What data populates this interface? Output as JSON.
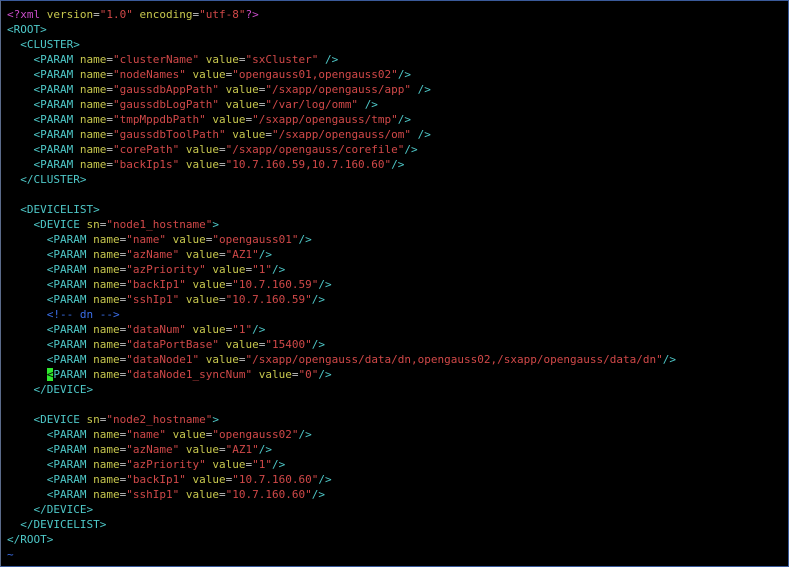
{
  "colors": {
    "background": "#000000",
    "tag": "#4ec8c8",
    "attribute_name": "#c8c84e",
    "attribute_value": "#d04848",
    "comment": "#3a6ee8",
    "declaration": "#c84cc8",
    "cursor": "#2ee82e"
  },
  "cursor": {
    "line": 24,
    "column": 3
  },
  "lines": [
    {
      "indent": "",
      "tokens": [
        [
          "decl",
          "<?"
        ],
        [
          "decl",
          "xml"
        ],
        [
          "plain",
          " "
        ],
        [
          "attr",
          "version"
        ],
        [
          "eq",
          "="
        ],
        [
          "str",
          "\"1.0\""
        ],
        [
          "plain",
          " "
        ],
        [
          "attr",
          "encoding"
        ],
        [
          "eq",
          "="
        ],
        [
          "str",
          "\"utf-8\""
        ],
        [
          "decl",
          "?>"
        ]
      ]
    },
    {
      "indent": "",
      "tokens": [
        [
          "tag",
          "<ROOT>"
        ]
      ]
    },
    {
      "indent": "  ",
      "tokens": [
        [
          "tag",
          "<CLUSTER>"
        ]
      ]
    },
    {
      "indent": "    ",
      "tokens": [
        [
          "tag",
          "<PARAM"
        ],
        [
          "plain",
          " "
        ],
        [
          "attr",
          "name"
        ],
        [
          "eq",
          "="
        ],
        [
          "str",
          "\"clusterName\""
        ],
        [
          "plain",
          " "
        ],
        [
          "attr",
          "value"
        ],
        [
          "eq",
          "="
        ],
        [
          "str",
          "\"sxCluster\""
        ],
        [
          "plain",
          " "
        ],
        [
          "tag",
          "/>"
        ]
      ]
    },
    {
      "indent": "    ",
      "tokens": [
        [
          "tag",
          "<PARAM"
        ],
        [
          "plain",
          " "
        ],
        [
          "attr",
          "name"
        ],
        [
          "eq",
          "="
        ],
        [
          "str",
          "\"nodeNames\""
        ],
        [
          "plain",
          " "
        ],
        [
          "attr",
          "value"
        ],
        [
          "eq",
          "="
        ],
        [
          "str",
          "\"opengauss01,opengauss02\""
        ],
        [
          "tag",
          "/>"
        ]
      ]
    },
    {
      "indent": "    ",
      "tokens": [
        [
          "tag",
          "<PARAM"
        ],
        [
          "plain",
          " "
        ],
        [
          "attr",
          "name"
        ],
        [
          "eq",
          "="
        ],
        [
          "str",
          "\"gaussdbAppPath\""
        ],
        [
          "plain",
          " "
        ],
        [
          "attr",
          "value"
        ],
        [
          "eq",
          "="
        ],
        [
          "str",
          "\"/sxapp/opengauss/app\""
        ],
        [
          "plain",
          " "
        ],
        [
          "tag",
          "/>"
        ]
      ]
    },
    {
      "indent": "    ",
      "tokens": [
        [
          "tag",
          "<PARAM"
        ],
        [
          "plain",
          " "
        ],
        [
          "attr",
          "name"
        ],
        [
          "eq",
          "="
        ],
        [
          "str",
          "\"gaussdbLogPath\""
        ],
        [
          "plain",
          " "
        ],
        [
          "attr",
          "value"
        ],
        [
          "eq",
          "="
        ],
        [
          "str",
          "\"/var/log/omm\""
        ],
        [
          "plain",
          " "
        ],
        [
          "tag",
          "/>"
        ]
      ]
    },
    {
      "indent": "    ",
      "tokens": [
        [
          "tag",
          "<PARAM"
        ],
        [
          "plain",
          " "
        ],
        [
          "attr",
          "name"
        ],
        [
          "eq",
          "="
        ],
        [
          "str",
          "\"tmpMppdbPath\""
        ],
        [
          "plain",
          " "
        ],
        [
          "attr",
          "value"
        ],
        [
          "eq",
          "="
        ],
        [
          "str",
          "\"/sxapp/opengauss/tmp\""
        ],
        [
          "tag",
          "/>"
        ]
      ]
    },
    {
      "indent": "    ",
      "tokens": [
        [
          "tag",
          "<PARAM"
        ],
        [
          "plain",
          " "
        ],
        [
          "attr",
          "name"
        ],
        [
          "eq",
          "="
        ],
        [
          "str",
          "\"gaussdbToolPath\""
        ],
        [
          "plain",
          " "
        ],
        [
          "attr",
          "value"
        ],
        [
          "eq",
          "="
        ],
        [
          "str",
          "\"/sxapp/opengauss/om\""
        ],
        [
          "plain",
          " "
        ],
        [
          "tag",
          "/>"
        ]
      ]
    },
    {
      "indent": "    ",
      "tokens": [
        [
          "tag",
          "<PARAM"
        ],
        [
          "plain",
          " "
        ],
        [
          "attr",
          "name"
        ],
        [
          "eq",
          "="
        ],
        [
          "str",
          "\"corePath\""
        ],
        [
          "plain",
          " "
        ],
        [
          "attr",
          "value"
        ],
        [
          "eq",
          "="
        ],
        [
          "str",
          "\"/sxapp/opengauss/corefile\""
        ],
        [
          "tag",
          "/>"
        ]
      ]
    },
    {
      "indent": "    ",
      "tokens": [
        [
          "tag",
          "<PARAM"
        ],
        [
          "plain",
          " "
        ],
        [
          "attr",
          "name"
        ],
        [
          "eq",
          "="
        ],
        [
          "str",
          "\"backIp1s\""
        ],
        [
          "plain",
          " "
        ],
        [
          "attr",
          "value"
        ],
        [
          "eq",
          "="
        ],
        [
          "str",
          "\"10.7.160.59,10.7.160.60\""
        ],
        [
          "tag",
          "/>"
        ]
      ]
    },
    {
      "indent": "  ",
      "tokens": [
        [
          "tag",
          "</CLUSTER>"
        ]
      ]
    },
    {
      "indent": "",
      "tokens": []
    },
    {
      "indent": "  ",
      "tokens": [
        [
          "tag",
          "<DEVICELIST>"
        ]
      ]
    },
    {
      "indent": "    ",
      "tokens": [
        [
          "tag",
          "<DEVICE"
        ],
        [
          "plain",
          " "
        ],
        [
          "attr",
          "sn"
        ],
        [
          "eq",
          "="
        ],
        [
          "str",
          "\"node1_hostname\""
        ],
        [
          "tag",
          ">"
        ]
      ]
    },
    {
      "indent": "      ",
      "tokens": [
        [
          "tag",
          "<PARAM"
        ],
        [
          "plain",
          " "
        ],
        [
          "attr",
          "name"
        ],
        [
          "eq",
          "="
        ],
        [
          "str",
          "\"name\""
        ],
        [
          "plain",
          " "
        ],
        [
          "attr",
          "value"
        ],
        [
          "eq",
          "="
        ],
        [
          "str",
          "\"opengauss01\""
        ],
        [
          "tag",
          "/>"
        ]
      ]
    },
    {
      "indent": "      ",
      "tokens": [
        [
          "tag",
          "<PARAM"
        ],
        [
          "plain",
          " "
        ],
        [
          "attr",
          "name"
        ],
        [
          "eq",
          "="
        ],
        [
          "str",
          "\"azName\""
        ],
        [
          "plain",
          " "
        ],
        [
          "attr",
          "value"
        ],
        [
          "eq",
          "="
        ],
        [
          "str",
          "\"AZ1\""
        ],
        [
          "tag",
          "/>"
        ]
      ]
    },
    {
      "indent": "      ",
      "tokens": [
        [
          "tag",
          "<PARAM"
        ],
        [
          "plain",
          " "
        ],
        [
          "attr",
          "name"
        ],
        [
          "eq",
          "="
        ],
        [
          "str",
          "\"azPriority\""
        ],
        [
          "plain",
          " "
        ],
        [
          "attr",
          "value"
        ],
        [
          "eq",
          "="
        ],
        [
          "str",
          "\"1\""
        ],
        [
          "tag",
          "/>"
        ]
      ]
    },
    {
      "indent": "      ",
      "tokens": [
        [
          "tag",
          "<PARAM"
        ],
        [
          "plain",
          " "
        ],
        [
          "attr",
          "name"
        ],
        [
          "eq",
          "="
        ],
        [
          "str",
          "\"backIp1\""
        ],
        [
          "plain",
          " "
        ],
        [
          "attr",
          "value"
        ],
        [
          "eq",
          "="
        ],
        [
          "str",
          "\"10.7.160.59\""
        ],
        [
          "tag",
          "/>"
        ]
      ]
    },
    {
      "indent": "      ",
      "tokens": [
        [
          "tag",
          "<PARAM"
        ],
        [
          "plain",
          " "
        ],
        [
          "attr",
          "name"
        ],
        [
          "eq",
          "="
        ],
        [
          "str",
          "\"sshIp1\""
        ],
        [
          "plain",
          " "
        ],
        [
          "attr",
          "value"
        ],
        [
          "eq",
          "="
        ],
        [
          "str",
          "\"10.7.160.59\""
        ],
        [
          "tag",
          "/>"
        ]
      ]
    },
    {
      "indent": "      ",
      "tokens": [
        [
          "comment",
          "<!-- dn -->"
        ]
      ]
    },
    {
      "indent": "      ",
      "tokens": [
        [
          "tag",
          "<PARAM"
        ],
        [
          "plain",
          " "
        ],
        [
          "attr",
          "name"
        ],
        [
          "eq",
          "="
        ],
        [
          "str",
          "\"dataNum\""
        ],
        [
          "plain",
          " "
        ],
        [
          "attr",
          "value"
        ],
        [
          "eq",
          "="
        ],
        [
          "str",
          "\"1\""
        ],
        [
          "tag",
          "/>"
        ]
      ]
    },
    {
      "indent": "      ",
      "tokens": [
        [
          "tag",
          "<PARAM"
        ],
        [
          "plain",
          " "
        ],
        [
          "attr",
          "name"
        ],
        [
          "eq",
          "="
        ],
        [
          "str",
          "\"dataPortBase\""
        ],
        [
          "plain",
          " "
        ],
        [
          "attr",
          "value"
        ],
        [
          "eq",
          "="
        ],
        [
          "str",
          "\"15400\""
        ],
        [
          "tag",
          "/>"
        ]
      ]
    },
    {
      "indent": "      ",
      "tokens": [
        [
          "tag",
          "<PARAM"
        ],
        [
          "plain",
          " "
        ],
        [
          "attr",
          "name"
        ],
        [
          "eq",
          "="
        ],
        [
          "str",
          "\"dataNode1\""
        ],
        [
          "plain",
          " "
        ],
        [
          "attr",
          "value"
        ],
        [
          "eq",
          "="
        ],
        [
          "str",
          "\"/sxapp/opengauss/data/dn,opengauss02,/sxapp/opengauss/data/dn\""
        ],
        [
          "tag",
          "/>"
        ]
      ]
    },
    {
      "indent": "      ",
      "tokens": [
        [
          "tag",
          "<PARAM"
        ],
        [
          "plain",
          " "
        ],
        [
          "attr",
          "name"
        ],
        [
          "eq",
          "="
        ],
        [
          "str",
          "\"dataNode1_syncNum\""
        ],
        [
          "plain",
          " "
        ],
        [
          "attr",
          "value"
        ],
        [
          "eq",
          "="
        ],
        [
          "str",
          "\"0\""
        ],
        [
          "tag",
          "/>"
        ]
      ]
    },
    {
      "indent": "    ",
      "tokens": [
        [
          "tag",
          "</DEVICE>"
        ]
      ]
    },
    {
      "indent": "",
      "tokens": []
    },
    {
      "indent": "    ",
      "tokens": [
        [
          "tag",
          "<DEVICE"
        ],
        [
          "plain",
          " "
        ],
        [
          "attr",
          "sn"
        ],
        [
          "eq",
          "="
        ],
        [
          "str",
          "\"node2_hostname\""
        ],
        [
          "tag",
          ">"
        ]
      ]
    },
    {
      "indent": "      ",
      "tokens": [
        [
          "tag",
          "<PARAM"
        ],
        [
          "plain",
          " "
        ],
        [
          "attr",
          "name"
        ],
        [
          "eq",
          "="
        ],
        [
          "str",
          "\"name\""
        ],
        [
          "plain",
          " "
        ],
        [
          "attr",
          "value"
        ],
        [
          "eq",
          "="
        ],
        [
          "str",
          "\"opengauss02\""
        ],
        [
          "tag",
          "/>"
        ]
      ]
    },
    {
      "indent": "      ",
      "tokens": [
        [
          "tag",
          "<PARAM"
        ],
        [
          "plain",
          " "
        ],
        [
          "attr",
          "name"
        ],
        [
          "eq",
          "="
        ],
        [
          "str",
          "\"azName\""
        ],
        [
          "plain",
          " "
        ],
        [
          "attr",
          "value"
        ],
        [
          "eq",
          "="
        ],
        [
          "str",
          "\"AZ1\""
        ],
        [
          "tag",
          "/>"
        ]
      ]
    },
    {
      "indent": "      ",
      "tokens": [
        [
          "tag",
          "<PARAM"
        ],
        [
          "plain",
          " "
        ],
        [
          "attr",
          "name"
        ],
        [
          "eq",
          "="
        ],
        [
          "str",
          "\"azPriority\""
        ],
        [
          "plain",
          " "
        ],
        [
          "attr",
          "value"
        ],
        [
          "eq",
          "="
        ],
        [
          "str",
          "\"1\""
        ],
        [
          "tag",
          "/>"
        ]
      ]
    },
    {
      "indent": "      ",
      "tokens": [
        [
          "tag",
          "<PARAM"
        ],
        [
          "plain",
          " "
        ],
        [
          "attr",
          "name"
        ],
        [
          "eq",
          "="
        ],
        [
          "str",
          "\"backIp1\""
        ],
        [
          "plain",
          " "
        ],
        [
          "attr",
          "value"
        ],
        [
          "eq",
          "="
        ],
        [
          "str",
          "\"10.7.160.60\""
        ],
        [
          "tag",
          "/>"
        ]
      ]
    },
    {
      "indent": "      ",
      "tokens": [
        [
          "tag",
          "<PARAM"
        ],
        [
          "plain",
          " "
        ],
        [
          "attr",
          "name"
        ],
        [
          "eq",
          "="
        ],
        [
          "str",
          "\"sshIp1\""
        ],
        [
          "plain",
          " "
        ],
        [
          "attr",
          "value"
        ],
        [
          "eq",
          "="
        ],
        [
          "str",
          "\"10.7.160.60\""
        ],
        [
          "tag",
          "/>"
        ]
      ]
    },
    {
      "indent": "    ",
      "tokens": [
        [
          "tag",
          "</DEVICE>"
        ]
      ]
    },
    {
      "indent": "  ",
      "tokens": [
        [
          "tag",
          "</DEVICELIST>"
        ]
      ]
    },
    {
      "indent": "",
      "tokens": [
        [
          "tag",
          "</ROOT>"
        ]
      ]
    },
    {
      "indent": "",
      "tokens": [
        [
          "tilde",
          "~"
        ]
      ]
    }
  ]
}
